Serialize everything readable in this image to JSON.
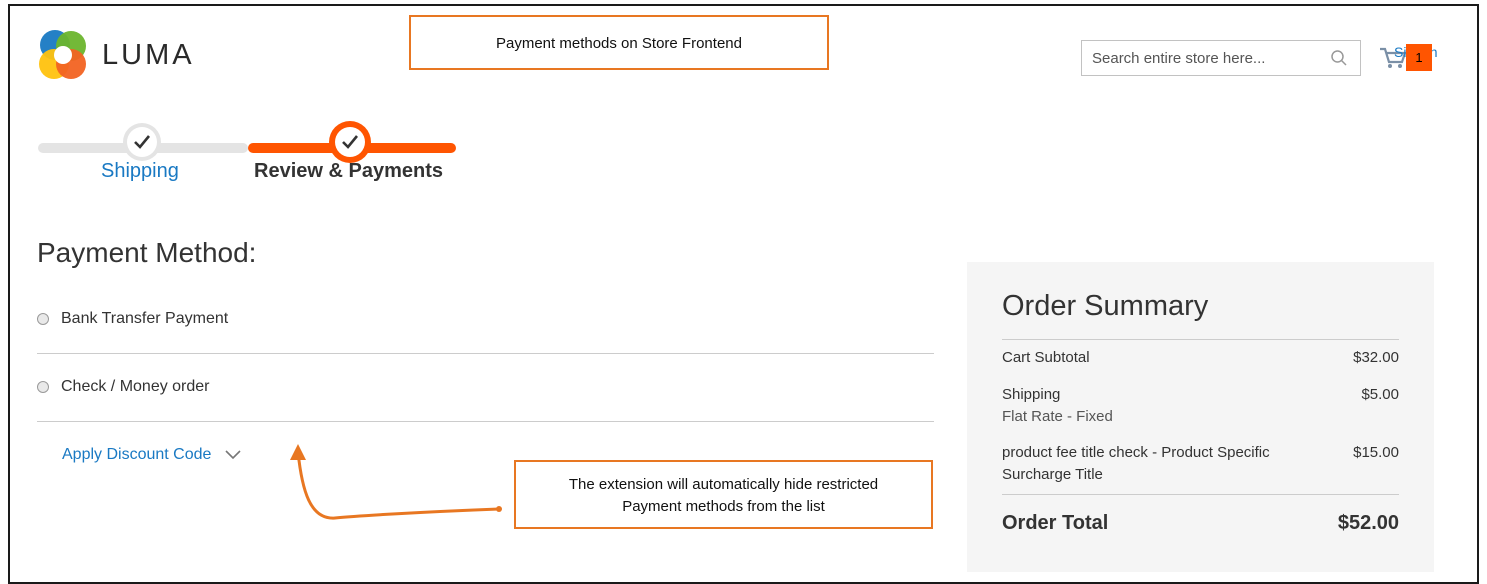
{
  "store": {
    "logo_text": "LUMA",
    "accent_color": "#ff5501",
    "link_color": "#1979c3"
  },
  "annotations": {
    "top_callout": "Payment methods on Store Frontend",
    "bottom_callout_line1": "The extension will automatically hide restricted",
    "bottom_callout_line2": "Payment methods from the list",
    "callout_border_color": "#e87722"
  },
  "header": {
    "search_placeholder": "Search entire store here...",
    "search_icon": "search-icon",
    "cart_icon": "shopping-cart-icon",
    "signin_label": "Sign In",
    "cart_count": "1"
  },
  "progress": {
    "steps": [
      {
        "label": "Shipping",
        "state": "completed"
      },
      {
        "label": "Review & Payments",
        "state": "active"
      }
    ]
  },
  "payment": {
    "title": "Payment Method:",
    "methods": [
      {
        "label": "Bank Transfer Payment",
        "selected": false
      },
      {
        "label": "Check / Money order",
        "selected": false
      }
    ],
    "discount_label": "Apply Discount Code"
  },
  "summary": {
    "title": "Order Summary",
    "rows": [
      {
        "label": "Cart Subtotal",
        "sub": "",
        "value": "$32.00"
      },
      {
        "label": "Shipping",
        "sub": "Flat Rate - Fixed",
        "value": "$5.00"
      },
      {
        "label": "product fee title check - Product Specific Surcharge Title",
        "sub": "",
        "value": "$15.00"
      }
    ],
    "total_label": "Order Total",
    "total_value": "$52.00"
  }
}
